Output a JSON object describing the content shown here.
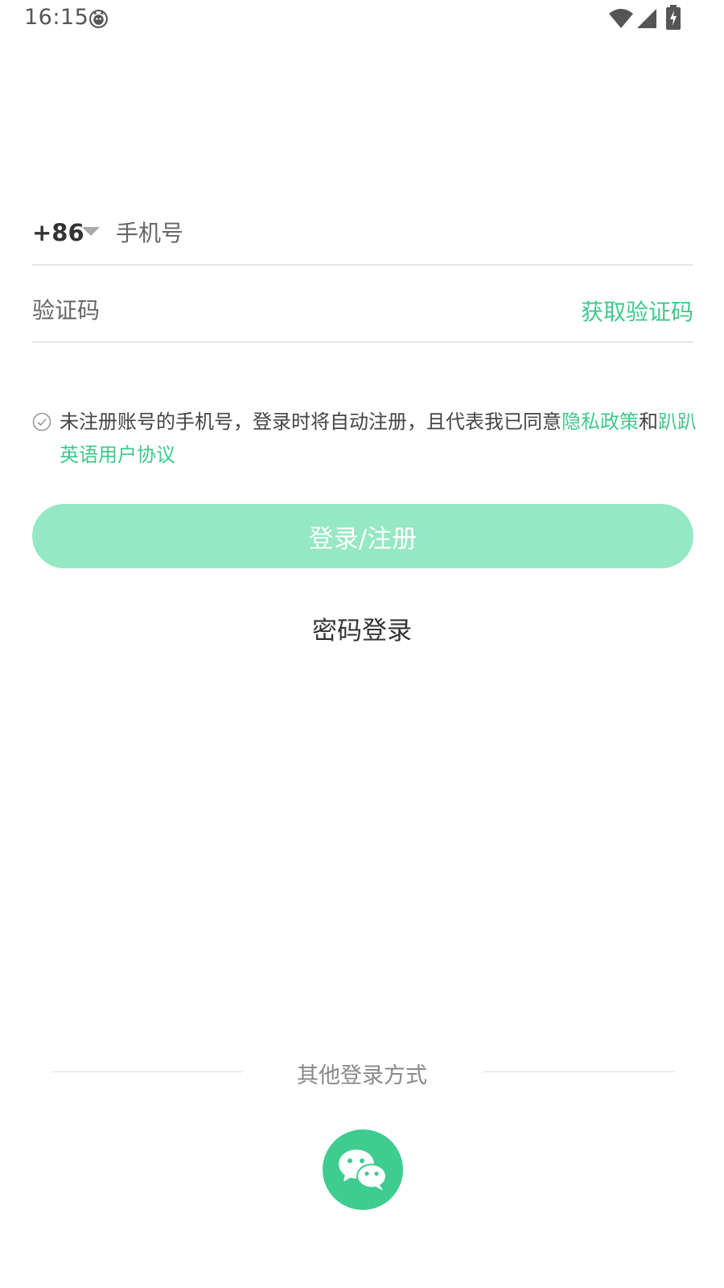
{
  "status_bar": {
    "time": "16:15",
    "notification_icon": "cat-face-icon",
    "wifi_icon": "wifi-icon",
    "signal_icon": "cell-signal-icon",
    "battery_icon": "battery-charging-icon"
  },
  "phone": {
    "country_code": "+86",
    "dropdown_icon": "caret-down-icon",
    "placeholder": "手机号",
    "value": ""
  },
  "verification": {
    "placeholder": "验证码",
    "value": "",
    "get_code_label": "获取验证码"
  },
  "agreement": {
    "checked": false,
    "check_icon": "check-circle-icon",
    "text_prefix": "未注册账号的手机号，登录时将自动注册，且代表我已同意",
    "privacy_link": "隐私政策",
    "conjunction": "和",
    "user_agreement_link": "趴趴英语用户协议"
  },
  "login_button_label": "登录/注册",
  "password_login_label": "密码登录",
  "other_login": {
    "label": "其他登录方式",
    "wechat_icon": "wechat-icon"
  },
  "colors": {
    "accent": "#3ec98c",
    "button_disabled": "#94e8c3",
    "wechat_bg": "#3ecc8f"
  }
}
